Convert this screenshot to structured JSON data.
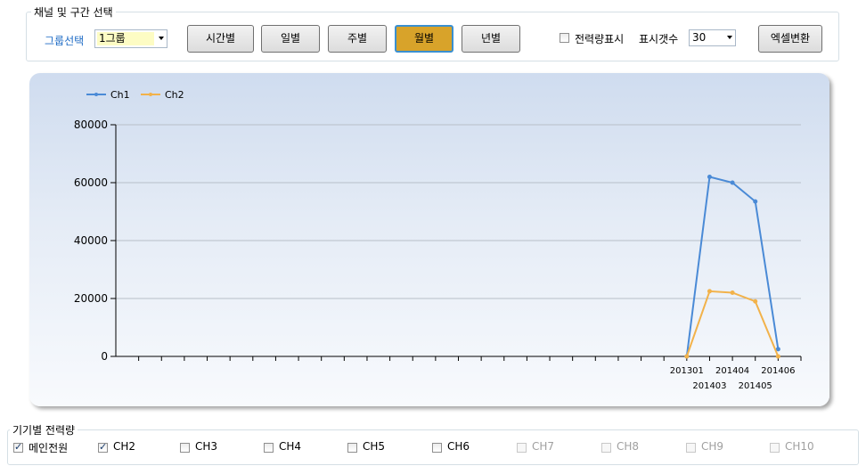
{
  "top_group": {
    "title": "채널 및 구간 선택",
    "group_label": "그룹선택",
    "group_value": "1그룹",
    "buttons": [
      "시간별",
      "일별",
      "주별",
      "월별",
      "년별"
    ],
    "active_button": "월별",
    "show_power_label": "전력량표시",
    "show_power_checked": false,
    "display_count_label": "표시갯수",
    "display_count_value": "30",
    "excel_button": "엑셀변환"
  },
  "colors": {
    "ch1": "#4a8ad6",
    "ch2": "#f2b24a",
    "active_button": "#d8a32a"
  },
  "chart_data": {
    "type": "line",
    "legend": [
      "Ch1",
      "Ch2"
    ],
    "legend_position": "top-left",
    "y_ticks": [
      "80000",
      "60000",
      "40000",
      "20000",
      "0"
    ],
    "ylim": [
      0,
      80000
    ],
    "x_tick_labels": [
      "201301",
      "201403",
      "201404",
      "201405",
      "201406"
    ],
    "grid": true,
    "series": [
      {
        "name": "Ch1",
        "points": [
          {
            "x": "201301",
            "y": 0
          },
          {
            "x": "201403",
            "y": 62000
          },
          {
            "x": "201404",
            "y": 60000
          },
          {
            "x": "201405",
            "y": 53500
          },
          {
            "x": "201406",
            "y": 2500
          }
        ]
      },
      {
        "name": "Ch2",
        "points": [
          {
            "x": "201301",
            "y": 0
          },
          {
            "x": "201403",
            "y": 22500
          },
          {
            "x": "201404",
            "y": 22000
          },
          {
            "x": "201405",
            "y": 19000
          },
          {
            "x": "201406",
            "y": 0
          }
        ]
      }
    ]
  },
  "bottom_group": {
    "title": "기기별 전력량",
    "channels": [
      {
        "label": "메인전원",
        "checked": true,
        "enabled": true
      },
      {
        "label": "CH2",
        "checked": true,
        "enabled": true
      },
      {
        "label": "CH3",
        "checked": false,
        "enabled": true
      },
      {
        "label": "CH4",
        "checked": false,
        "enabled": true
      },
      {
        "label": "CH5",
        "checked": false,
        "enabled": true
      },
      {
        "label": "CH6",
        "checked": false,
        "enabled": true
      },
      {
        "label": "CH7",
        "checked": false,
        "enabled": false
      },
      {
        "label": "CH8",
        "checked": false,
        "enabled": false
      },
      {
        "label": "CH9",
        "checked": false,
        "enabled": false
      },
      {
        "label": "CH10",
        "checked": false,
        "enabled": false
      }
    ]
  }
}
